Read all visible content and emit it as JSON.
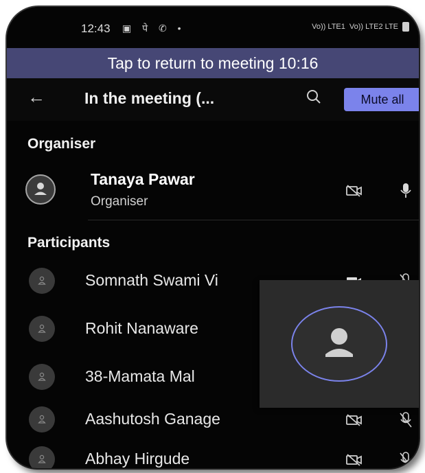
{
  "status_bar": {
    "time": "12:43",
    "left_icons": "▣ पे ✆ •",
    "right_icons": [
      "Vo)) LTE1",
      "Vo)) LTE2 LTE"
    ]
  },
  "return_banner": {
    "text": "Tap to return to meeting 10:16"
  },
  "header": {
    "title": "In the meeting (...",
    "mute_all_label": "Mute all"
  },
  "organiser_section": {
    "title": "Organiser",
    "name": "Tanaya Pawar",
    "role": "Organiser"
  },
  "participants_section": {
    "title": "Participants",
    "items": [
      {
        "name": "Somnath Swami Vi",
        "camera": "on",
        "mic": "muted"
      },
      {
        "name": "Rohit Nanaware",
        "camera": "off",
        "mic": "muted"
      },
      {
        "name": "38-Mamata Mal",
        "camera": "off",
        "mic": "muted"
      },
      {
        "name": "Aashutosh Ganage",
        "camera": "off",
        "mic": "muted"
      },
      {
        "name": "Abhay Hirgude",
        "camera": "off",
        "mic": "muted"
      }
    ]
  },
  "colors": {
    "banner": "#464775",
    "accent": "#7b83eb",
    "background": "#050505"
  }
}
